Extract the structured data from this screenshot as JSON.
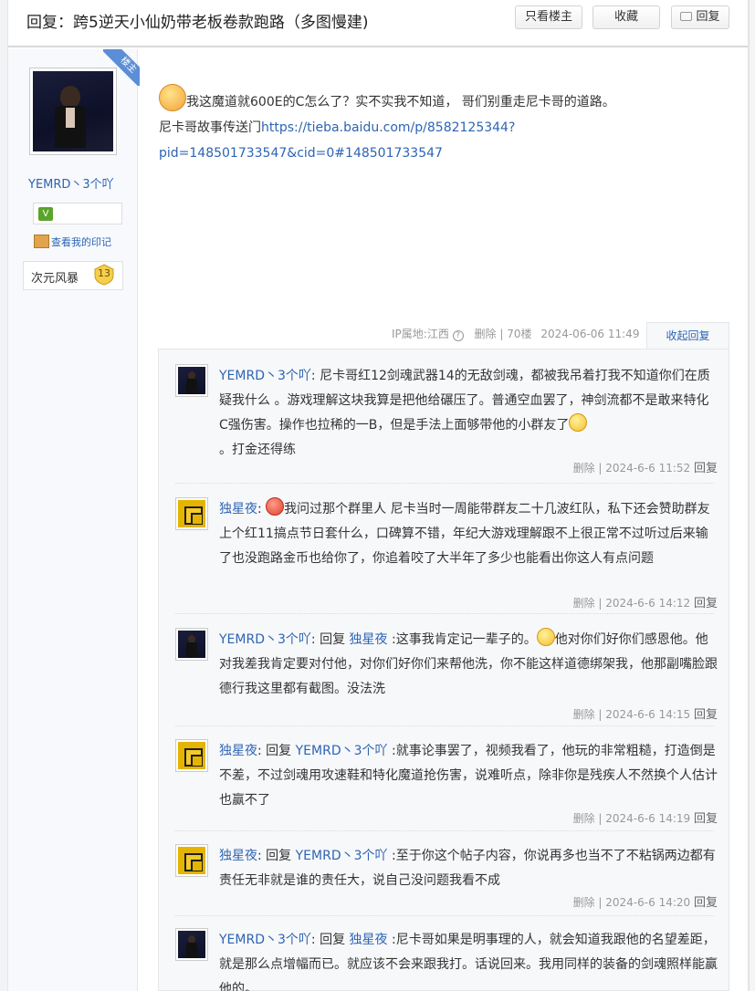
{
  "header": {
    "title": "回复：跨5逆天小仙奶带老板卷款跑路（多图慢建)",
    "only_lz": "只看楼主",
    "favorite": "收藏",
    "reply": "回复"
  },
  "author": {
    "louzhu_tag": "楼主",
    "name": "YEMRD丶3个吖",
    "my_mark": "查看我的印记",
    "level_name": "次元风暴",
    "level": "13"
  },
  "post": {
    "line1": "我这魔道就600E的C怎么了？实不实我不知道， 哥们别重走尼卡哥的道路。",
    "line2_prefix": "尼卡哥故事传送门",
    "link": "https://tieba.baidu.com/p/8582125344?pid=148501733547&cid=0#148501733547",
    "meta": {
      "ip": "IP属地:江西",
      "delete": "删除",
      "floor": "70楼",
      "time": "2024-06-06 11:49"
    },
    "collapse": "收起回复"
  },
  "comments": [
    {
      "user": "YEMRD丶3个吖",
      "reply_prefix": "",
      "reply_to": "",
      "text1": "尼卡哥红12剑魂武器14的无敌剑魂，都被我吊着打我不知道你们在质疑我什么 。游戏理解这块我算是把他给碾压了。普通空血罢了，神剑流都不是敢来特化C强伤害。操作也拉稀的一B，但是手法上面够带他的小群友了",
      "text2": "。打金还得练",
      "meta": "删除 | 2024-6-6 11:52",
      "reply": "回复"
    },
    {
      "user": "独星夜",
      "reply_prefix": "",
      "reply_to": "",
      "text1": "我问过那个群里人 尼卡当时一周能带群友二十几波红队，私下还会赞助群友上个红11搞点节日套什么，口碑算不错，年纪大游戏理解跟不上很正常不过听过后来输了也没跑路金币也给你了，你追着咬了大半年了多少也能看出你这人有点问题",
      "text2": "",
      "meta": "删除 | 2024-6-6 14:12",
      "reply": "回复"
    },
    {
      "user": "YEMRD丶3个吖",
      "reply_prefix": "回复",
      "reply_to": "独星夜",
      "text1": ":这事我肯定记一辈子的。",
      "text2": "他对你们好你们感恩他。他对我差我肯定要对付他，对你们好你们来帮他洗，你不能这样道德绑架我，他那副嘴脸跟德行我这里都有截图。没法洗",
      "meta": "删除 | 2024-6-6 14:15",
      "reply": "回复"
    },
    {
      "user": "独星夜",
      "reply_prefix": "回复",
      "reply_to": "YEMRD丶3个吖",
      "text1": ":就事论事罢了，视频我看了，他玩的非常粗糙，打造倒是不差，不过剑魂用攻速鞋和特化魔道抢伤害，说难听点，除非你是残疾人不然换个人估计也赢不了",
      "text2": "",
      "meta": "删除 | 2024-6-6 14:19",
      "reply": "回复"
    },
    {
      "user": "独星夜",
      "reply_prefix": "回复",
      "reply_to": "YEMRD丶3个吖",
      "text1": ":至于你这个帖子内容，你说再多也当不了不粘锅两边都有责任无非就是谁的责任大，说自己没问题我看不成",
      "text2": "",
      "meta": "删除 | 2024-6-6 14:20",
      "reply": "回复"
    },
    {
      "user": "YEMRD丶3个吖",
      "reply_prefix": "回复",
      "reply_to": "独星夜",
      "text1": ":尼卡哥如果是明事理的人，就会知道我跟他的名望差距，就是那么点增幅而已。就应该不会来跟我打。话说回来。我用同样的装备的剑魂照样能赢他的。",
      "text2": "",
      "meta": "",
      "reply": ""
    }
  ]
}
